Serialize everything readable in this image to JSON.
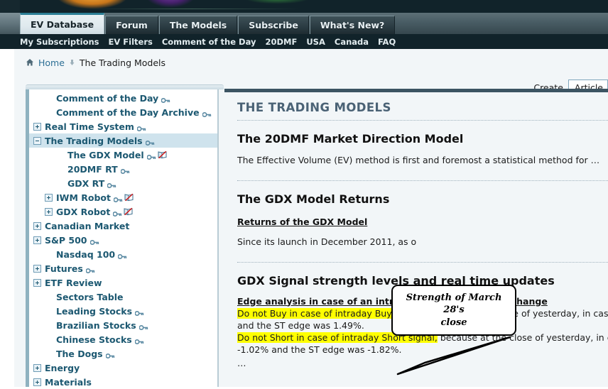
{
  "banner": {
    "alt": "site-banner-artwork"
  },
  "tabs": [
    {
      "label": "EV Database",
      "active": true
    },
    {
      "label": "Forum",
      "active": false
    },
    {
      "label": "The Models",
      "active": false
    },
    {
      "label": "Subscribe",
      "active": false
    },
    {
      "label": "What's New?",
      "active": false
    }
  ],
  "subnav": [
    "My Subscriptions",
    "EV Filters",
    "Comment of the Day",
    "20DMF",
    "USA",
    "Canada",
    "FAQ"
  ],
  "breadcrumb": {
    "home_label": "Home",
    "separator": "‣",
    "current": "The Trading Models"
  },
  "create": {
    "label": "Create",
    "selected": "Article"
  },
  "sidebar": {
    "items": [
      {
        "label": "Comment of the Day",
        "toggle": "none",
        "indent": 1,
        "key": true,
        "book": false,
        "selected": false
      },
      {
        "label": "Comment of the Day Archive",
        "toggle": "none",
        "indent": 1,
        "key": true,
        "book": false,
        "selected": false
      },
      {
        "label": "Real Time System",
        "toggle": "plus",
        "indent": 0,
        "key": true,
        "book": false,
        "selected": false
      },
      {
        "label": "The Trading Models",
        "toggle": "minus",
        "indent": 0,
        "key": true,
        "book": false,
        "selected": true
      },
      {
        "label": "The GDX Model",
        "toggle": "none",
        "indent": 2,
        "key": true,
        "book": true,
        "selected": false
      },
      {
        "label": "20DMF RT",
        "toggle": "none",
        "indent": 2,
        "key": true,
        "book": false,
        "selected": false
      },
      {
        "label": "GDX RT",
        "toggle": "none",
        "indent": 2,
        "key": true,
        "book": false,
        "selected": false
      },
      {
        "label": "IWM Robot",
        "toggle": "plus",
        "indent": 1,
        "key": true,
        "book": true,
        "selected": false
      },
      {
        "label": "GDX Robot",
        "toggle": "plus",
        "indent": 1,
        "key": true,
        "book": true,
        "selected": false
      },
      {
        "label": "Canadian Market",
        "toggle": "plus",
        "indent": 0,
        "key": false,
        "book": false,
        "selected": false
      },
      {
        "label": "S&P 500",
        "toggle": "plus",
        "indent": 0,
        "key": true,
        "book": false,
        "selected": false
      },
      {
        "label": "Nasdaq 100",
        "toggle": "none",
        "indent": 1,
        "key": true,
        "book": false,
        "selected": false
      },
      {
        "label": "Futures",
        "toggle": "plus",
        "indent": 0,
        "key": true,
        "book": false,
        "selected": false
      },
      {
        "label": "ETF Review",
        "toggle": "plus",
        "indent": 0,
        "key": false,
        "book": false,
        "selected": false
      },
      {
        "label": "Sectors Table",
        "toggle": "none",
        "indent": 1,
        "key": false,
        "book": false,
        "selected": false
      },
      {
        "label": "Leading Stocks",
        "toggle": "none",
        "indent": 1,
        "key": true,
        "book": false,
        "selected": false
      },
      {
        "label": "Brazilian Stocks",
        "toggle": "none",
        "indent": 1,
        "key": true,
        "book": false,
        "selected": false
      },
      {
        "label": "Chinese Stocks",
        "toggle": "none",
        "indent": 1,
        "key": true,
        "book": false,
        "selected": false
      },
      {
        "label": "The Dogs",
        "toggle": "none",
        "indent": 1,
        "key": true,
        "book": false,
        "selected": false
      },
      {
        "label": "Energy",
        "toggle": "plus",
        "indent": 0,
        "key": false,
        "book": false,
        "selected": false
      },
      {
        "label": "Materials",
        "toggle": "plus",
        "indent": 0,
        "key": false,
        "book": false,
        "selected": false
      }
    ]
  },
  "main": {
    "page_title": "THE TRADING MODELS",
    "section1": {
      "heading": "The 20DMF Market Direction Model",
      "body": "The Effective Volume (EV) method is first and foremost a statistical method for …"
    },
    "section2": {
      "heading": "The GDX Model Returns",
      "link": "Returns of the GDX Model",
      "body": "Since its launch in December 2011, as o"
    },
    "section3": {
      "heading": "GDX Signal strength levels and real time updates",
      "edge_heading": "Edge analysis in case of an intraday real time GDX MF change",
      "line1_hl": "Do not Buy in case of intraday Buy signal,",
      "line1_rest": " because at the close of yesterday, in case of a Buy signal",
      "line2": "and the ST edge was 1.49%.",
      "line3_hl": "Do not Short in case of intraday Short signal,",
      "line3_rest": " because at the close of yesterday, in case of a Short",
      "line4": "-1.02% and the ST edge was -1.82%.",
      "ellipsis": "…"
    }
  },
  "callout": {
    "text_line1": "Strength of March 28's",
    "text_line2": "close"
  },
  "colors": {
    "banner_dark": "#11232a",
    "tab_active_bg": "#e9f1f4",
    "tab_active_top": "#2d7f96",
    "page_bg": "#f2f6f8",
    "sidebar_text": "#1c5871",
    "sidebar_selected": "#cfe3ed",
    "main_top_border": "#3c5462",
    "highlight_yellow": "#ffff00",
    "link_blue": "#2c6f95",
    "page_title": "#4a6275"
  }
}
